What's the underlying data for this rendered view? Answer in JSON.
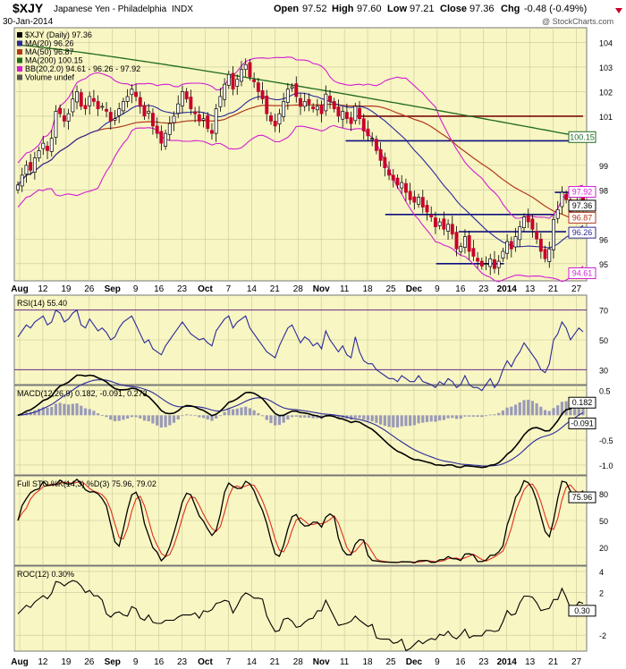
{
  "header": {
    "symbol": "$XJY",
    "name": "Japanese Yen - Philadelphia",
    "exchange": "INDX",
    "date": "30-Jan-2014",
    "open_label": "Open",
    "open": "97.52",
    "high_label": "High",
    "high": "97.60",
    "low_label": "Low",
    "low": "97.21",
    "close_label": "Close",
    "close": "97.36",
    "chg_label": "Chg",
    "chg": "-0.48 (-0.49%)",
    "watermark": "@ StockCharts.com"
  },
  "colors": {
    "panel_bg": "#f8f6c3",
    "grid": "#c9c79a",
    "up": "#ffffff",
    "down": "#c8002a",
    "ma20": "#2a2a9a",
    "ma50": "#b03a1e",
    "ma200": "#1e6a1e",
    "bb": "#d21fd2",
    "trend_green": "#1a7a1a",
    "resistance_red": "#7a0a0a",
    "support_navy": "#101080"
  },
  "chart_data": [
    {
      "type": "candlestick",
      "title": "$XJY (Daily) 97.36",
      "legend": [
        {
          "label": "$XJY (Daily)",
          "value": "97.36",
          "color": "#000000"
        },
        {
          "label": "MA(20)",
          "value": "96.26",
          "color": "#2a2a9a"
        },
        {
          "label": "MA(50)",
          "value": "96.87",
          "color": "#b03a1e"
        },
        {
          "label": "MA(200)",
          "value": "100.15",
          "color": "#1e6a1e"
        },
        {
          "label": "BB(20,2.0)",
          "value": "94.61 - 96.26 - 97.92",
          "color": "#d21fd2"
        },
        {
          "label": "Volume undef",
          "value": "",
          "color": "#555555"
        }
      ],
      "y_ticks": [
        "104",
        "103",
        "102",
        "101",
        "99",
        "98",
        "96",
        "95"
      ],
      "ylim": [
        94.3,
        104.6
      ],
      "right_tags": [
        {
          "text": "100.15",
          "value": 100.15,
          "color": "#1e6a1e"
        },
        {
          "text": "97.92",
          "value": 97.92,
          "color": "#d21fd2"
        },
        {
          "text": "97.36",
          "value": 97.36,
          "color": "#000000"
        },
        {
          "text": "96.87",
          "value": 96.87,
          "color": "#b03a1e"
        },
        {
          "text": "96.26",
          "value": 96.26,
          "color": "#2a2a9a"
        },
        {
          "text": "94.61",
          "value": 94.61,
          "color": "#d21fd2"
        }
      ],
      "x_labels": [
        "Aug",
        "12",
        "19",
        "26",
        "Sep",
        "9",
        "16",
        "23",
        "Oct",
        "7",
        "14",
        "21",
        "28",
        "Nov",
        "11",
        "18",
        "25",
        "Dec",
        "9",
        "16",
        "23",
        "2014",
        "13",
        "21",
        "27"
      ],
      "close_series": [
        98.2,
        98.6,
        99.0,
        98.8,
        99.3,
        99.6,
        99.9,
        99.6,
        100.1,
        101.2,
        101.1,
        100.8,
        101.1,
        101.7,
        102.0,
        101.4,
        101.3,
        101.8,
        101.6,
        101.3,
        101.4,
        101.2,
        100.8,
        100.9,
        101.3,
        101.6,
        101.8,
        102.1,
        101.8,
        101.4,
        101.0,
        101.2,
        100.6,
        100.3,
        99.9,
        100.3,
        100.7,
        101.0,
        101.5,
        102.0,
        101.7,
        101.3,
        101.1,
        100.8,
        100.9,
        100.5,
        100.3,
        101.3,
        101.8,
        102.3,
        102.7,
        102.1,
        102.5,
        102.9,
        103.1,
        102.6,
        102.4,
        102.0,
        101.7,
        101.1,
        100.8,
        100.6,
        101.1,
        101.6,
        102.1,
        102.2,
        101.8,
        101.4,
        101.6,
        101.5,
        101.3,
        101.4,
        101.1,
        101.9,
        101.6,
        101.3,
        101.0,
        101.2,
        100.9,
        100.7,
        101.4,
        100.9,
        100.4,
        100.2,
        100.1,
        99.6,
        99.2,
        98.9,
        98.6,
        98.4,
        98.2,
        98.3,
        97.9,
        97.6,
        97.5,
        97.7,
        97.3,
        97.1,
        96.9,
        96.5,
        96.7,
        96.4,
        96.6,
        96.2,
        95.6,
        95.7,
        96.1,
        95.5,
        95.3,
        95.1,
        94.9,
        95.0,
        95.2,
        94.8,
        95.1,
        95.5,
        95.9,
        95.6,
        96.1,
        96.5,
        96.9,
        96.7,
        96.4,
        96.0,
        95.5,
        95.2,
        95.6,
        96.8,
        97.2,
        97.9,
        97.6,
        97.0,
        97.4,
        97.8,
        97.36
      ],
      "annotations": [
        {
          "kind": "resistance",
          "y": 101.0
        },
        {
          "kind": "resistance",
          "y": 100.0
        },
        {
          "kind": "level",
          "y": 97.9
        },
        {
          "kind": "level",
          "y": 97.0
        },
        {
          "kind": "level",
          "y": 96.3
        },
        {
          "kind": "level",
          "y": 95.0
        }
      ]
    },
    {
      "type": "line",
      "title": "RSI(14) 55.40",
      "series": [
        {
          "name": "RSI(14)",
          "value": "55.40",
          "color": "#2a2a9a"
        }
      ],
      "ylim": [
        20,
        80
      ],
      "y_ticks": [
        "70",
        "50",
        "30"
      ],
      "right_tags": [
        {
          "text": "55.40",
          "value": 55.4
        }
      ],
      "values": [
        52,
        56,
        60,
        58,
        62,
        64,
        66,
        60,
        62,
        70,
        68,
        62,
        64,
        68,
        70,
        60,
        58,
        64,
        60,
        56,
        58,
        55,
        50,
        52,
        58,
        62,
        64,
        66,
        60,
        54,
        48,
        50,
        44,
        42,
        40,
        46,
        50,
        54,
        58,
        62,
        58,
        54,
        52,
        50,
        51,
        48,
        46,
        56,
        60,
        64,
        66,
        58,
        62,
        64,
        66,
        58,
        54,
        50,
        46,
        42,
        40,
        38,
        46,
        52,
        58,
        60,
        54,
        48,
        52,
        50,
        46,
        48,
        44,
        56,
        50,
        46,
        42,
        46,
        40,
        38,
        52,
        42,
        36,
        34,
        34,
        30,
        28,
        26,
        24,
        24,
        22,
        26,
        24,
        22,
        22,
        26,
        22,
        21,
        20,
        18,
        22,
        20,
        24,
        22,
        18,
        20,
        26,
        20,
        18,
        18,
        16,
        20,
        24,
        18,
        22,
        30,
        36,
        32,
        38,
        42,
        48,
        44,
        40,
        36,
        30,
        28,
        34,
        50,
        54,
        62,
        58,
        50,
        54,
        58,
        55.4
      ]
    },
    {
      "type": "line",
      "title": "MACD(12,26,9) 0.182, -0.091, 0.273",
      "series": [
        {
          "name": "MACD(12,26,9)",
          "value": "0.182",
          "color": "#000000"
        },
        {
          "name": "Signal",
          "value": "-0.091",
          "color": "#2a2a9a"
        },
        {
          "name": "Histogram",
          "value": "0.273",
          "color": "#8080a0"
        }
      ],
      "ylim": [
        -1.2,
        0.6
      ],
      "y_ticks": [
        "0.5",
        "-0.5",
        "-1.0"
      ],
      "right_tags": [
        {
          "text": "0.182",
          "value": 0.182
        },
        {
          "text": "-0.091",
          "value": -0.091
        }
      ]
    },
    {
      "type": "line",
      "title": "Full STO %K(14,3) %D(3) 75.96, 79.02",
      "series": [
        {
          "name": "%K(14,3)",
          "value": "75.96",
          "color": "#000000"
        },
        {
          "name": "%D(3)",
          "value": "79.02",
          "color": "#e03020"
        }
      ],
      "ylim": [
        0,
        100
      ],
      "y_ticks": [
        "80",
        "50",
        "20"
      ],
      "right_tags": [
        {
          "text": "75.96",
          "value": 75.96
        }
      ]
    },
    {
      "type": "line",
      "title": "ROC(12) 0.30%",
      "series": [
        {
          "name": "ROC(12)",
          "value": "0.30%",
          "color": "#000000"
        }
      ],
      "ylim": [
        -3.5,
        4.5
      ],
      "y_ticks": [
        "4",
        "2",
        "-2"
      ],
      "right_tags": [
        {
          "text": "0.30",
          "value": 0.3
        }
      ]
    }
  ]
}
